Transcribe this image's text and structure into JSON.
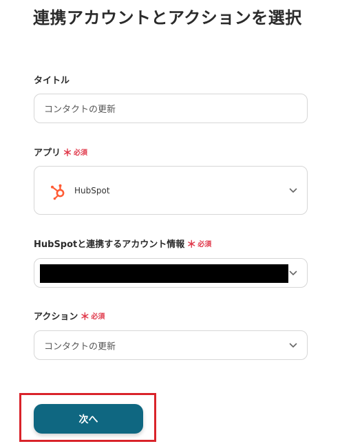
{
  "page": {
    "title": "連携アカウントとアクションを選択"
  },
  "fields": {
    "title": {
      "label": "タイトル",
      "value": "コンタクトの更新"
    },
    "app": {
      "label": "アプリ",
      "required_mark": "＊",
      "required_text": "必須",
      "value": "HubSpot",
      "logo_icon": "hubspot-logo"
    },
    "account": {
      "label": "HubSpotと連携するアカウント情報",
      "required_mark": "＊",
      "required_text": "必須"
    },
    "action": {
      "label": "アクション",
      "required_mark": "＊",
      "required_text": "必須",
      "value": "コンタクトの更新"
    }
  },
  "buttons": {
    "next_label": "次へ"
  },
  "colors": {
    "required": "#e0394b",
    "primary_button": "#0f6781",
    "highlight_border": "#d9232a",
    "hubspot_orange": "#ff5c35"
  }
}
